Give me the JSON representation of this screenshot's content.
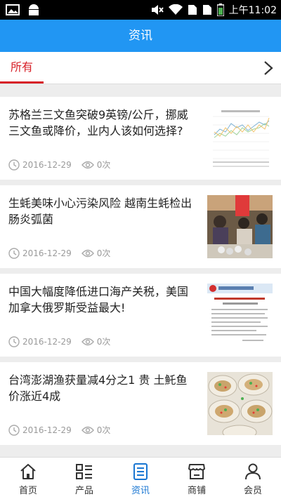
{
  "status_bar": {
    "time": "上午11:02"
  },
  "header": {
    "title": "资讯"
  },
  "tabs": {
    "active_label": "所有"
  },
  "articles": [
    {
      "title": "苏格兰三文鱼突破9英镑/公斤，挪威三文鱼或降价，业内人该如何选择?",
      "date": "2016-12-29",
      "views": "0次",
      "thumb": "price-chart"
    },
    {
      "title": "生蚝美味小心污染风险 越南生蚝检出肠炎弧菌",
      "date": "2016-12-29",
      "views": "0次",
      "thumb": "market-photo"
    },
    {
      "title": "中国大幅度降低进口海产关税，美国加拿大俄罗斯受益最大!",
      "date": "2016-12-29",
      "views": "0次",
      "thumb": "document"
    },
    {
      "title": "台湾澎湖渔获量减4分之1 贵 土魠鱼价涨近4成",
      "date": "2016-12-29",
      "views": "0次",
      "thumb": "oysters-photo"
    }
  ],
  "bottom_nav": [
    {
      "label": "首页",
      "icon": "home-icon"
    },
    {
      "label": "产品",
      "icon": "grid-list-icon"
    },
    {
      "label": "资讯",
      "icon": "news-icon",
      "active": true
    },
    {
      "label": "商铺",
      "icon": "shop-icon"
    },
    {
      "label": "会员",
      "icon": "user-icon"
    }
  ],
  "colors": {
    "header": "#2196f3",
    "accent": "#d71f27",
    "active_nav": "#1976d2"
  }
}
